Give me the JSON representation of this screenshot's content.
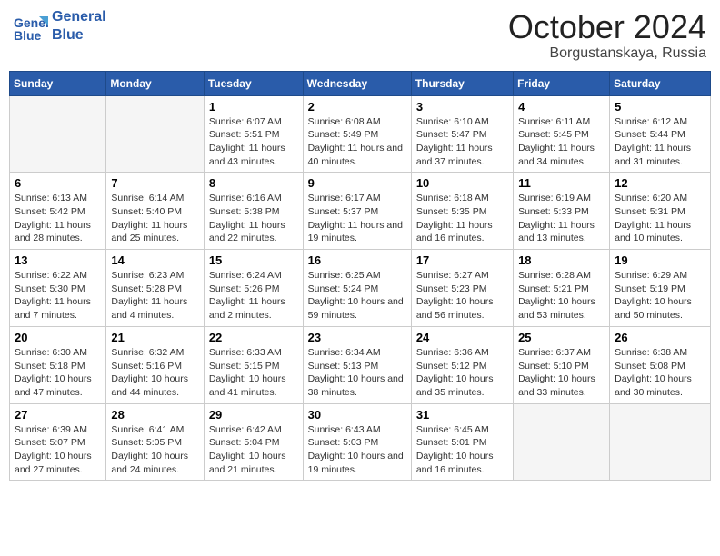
{
  "header": {
    "logo_general": "General",
    "logo_blue": "Blue",
    "month_title": "October 2024",
    "location": "Borgustanskaya, Russia"
  },
  "days_of_week": [
    "Sunday",
    "Monday",
    "Tuesday",
    "Wednesday",
    "Thursday",
    "Friday",
    "Saturday"
  ],
  "weeks": [
    [
      null,
      null,
      {
        "day": "1",
        "sunrise": "6:07 AM",
        "sunset": "5:51 PM",
        "daylight": "11 hours and 43 minutes."
      },
      {
        "day": "2",
        "sunrise": "6:08 AM",
        "sunset": "5:49 PM",
        "daylight": "11 hours and 40 minutes."
      },
      {
        "day": "3",
        "sunrise": "6:10 AM",
        "sunset": "5:47 PM",
        "daylight": "11 hours and 37 minutes."
      },
      {
        "day": "4",
        "sunrise": "6:11 AM",
        "sunset": "5:45 PM",
        "daylight": "11 hours and 34 minutes."
      },
      {
        "day": "5",
        "sunrise": "6:12 AM",
        "sunset": "5:44 PM",
        "daylight": "11 hours and 31 minutes."
      }
    ],
    [
      {
        "day": "6",
        "sunrise": "6:13 AM",
        "sunset": "5:42 PM",
        "daylight": "11 hours and 28 minutes."
      },
      {
        "day": "7",
        "sunrise": "6:14 AM",
        "sunset": "5:40 PM",
        "daylight": "11 hours and 25 minutes."
      },
      {
        "day": "8",
        "sunrise": "6:16 AM",
        "sunset": "5:38 PM",
        "daylight": "11 hours and 22 minutes."
      },
      {
        "day": "9",
        "sunrise": "6:17 AM",
        "sunset": "5:37 PM",
        "daylight": "11 hours and 19 minutes."
      },
      {
        "day": "10",
        "sunrise": "6:18 AM",
        "sunset": "5:35 PM",
        "daylight": "11 hours and 16 minutes."
      },
      {
        "day": "11",
        "sunrise": "6:19 AM",
        "sunset": "5:33 PM",
        "daylight": "11 hours and 13 minutes."
      },
      {
        "day": "12",
        "sunrise": "6:20 AM",
        "sunset": "5:31 PM",
        "daylight": "11 hours and 10 minutes."
      }
    ],
    [
      {
        "day": "13",
        "sunrise": "6:22 AM",
        "sunset": "5:30 PM",
        "daylight": "11 hours and 7 minutes."
      },
      {
        "day": "14",
        "sunrise": "6:23 AM",
        "sunset": "5:28 PM",
        "daylight": "11 hours and 4 minutes."
      },
      {
        "day": "15",
        "sunrise": "6:24 AM",
        "sunset": "5:26 PM",
        "daylight": "11 hours and 2 minutes."
      },
      {
        "day": "16",
        "sunrise": "6:25 AM",
        "sunset": "5:24 PM",
        "daylight": "10 hours and 59 minutes."
      },
      {
        "day": "17",
        "sunrise": "6:27 AM",
        "sunset": "5:23 PM",
        "daylight": "10 hours and 56 minutes."
      },
      {
        "day": "18",
        "sunrise": "6:28 AM",
        "sunset": "5:21 PM",
        "daylight": "10 hours and 53 minutes."
      },
      {
        "day": "19",
        "sunrise": "6:29 AM",
        "sunset": "5:19 PM",
        "daylight": "10 hours and 50 minutes."
      }
    ],
    [
      {
        "day": "20",
        "sunrise": "6:30 AM",
        "sunset": "5:18 PM",
        "daylight": "10 hours and 47 minutes."
      },
      {
        "day": "21",
        "sunrise": "6:32 AM",
        "sunset": "5:16 PM",
        "daylight": "10 hours and 44 minutes."
      },
      {
        "day": "22",
        "sunrise": "6:33 AM",
        "sunset": "5:15 PM",
        "daylight": "10 hours and 41 minutes."
      },
      {
        "day": "23",
        "sunrise": "6:34 AM",
        "sunset": "5:13 PM",
        "daylight": "10 hours and 38 minutes."
      },
      {
        "day": "24",
        "sunrise": "6:36 AM",
        "sunset": "5:12 PM",
        "daylight": "10 hours and 35 minutes."
      },
      {
        "day": "25",
        "sunrise": "6:37 AM",
        "sunset": "5:10 PM",
        "daylight": "10 hours and 33 minutes."
      },
      {
        "day": "26",
        "sunrise": "6:38 AM",
        "sunset": "5:08 PM",
        "daylight": "10 hours and 30 minutes."
      }
    ],
    [
      {
        "day": "27",
        "sunrise": "6:39 AM",
        "sunset": "5:07 PM",
        "daylight": "10 hours and 27 minutes."
      },
      {
        "day": "28",
        "sunrise": "6:41 AM",
        "sunset": "5:05 PM",
        "daylight": "10 hours and 24 minutes."
      },
      {
        "day": "29",
        "sunrise": "6:42 AM",
        "sunset": "5:04 PM",
        "daylight": "10 hours and 21 minutes."
      },
      {
        "day": "30",
        "sunrise": "6:43 AM",
        "sunset": "5:03 PM",
        "daylight": "10 hours and 19 minutes."
      },
      {
        "day": "31",
        "sunrise": "6:45 AM",
        "sunset": "5:01 PM",
        "daylight": "10 hours and 16 minutes."
      },
      null,
      null
    ]
  ],
  "labels": {
    "sunrise": "Sunrise: ",
    "sunset": "Sunset: ",
    "daylight": "Daylight: "
  }
}
